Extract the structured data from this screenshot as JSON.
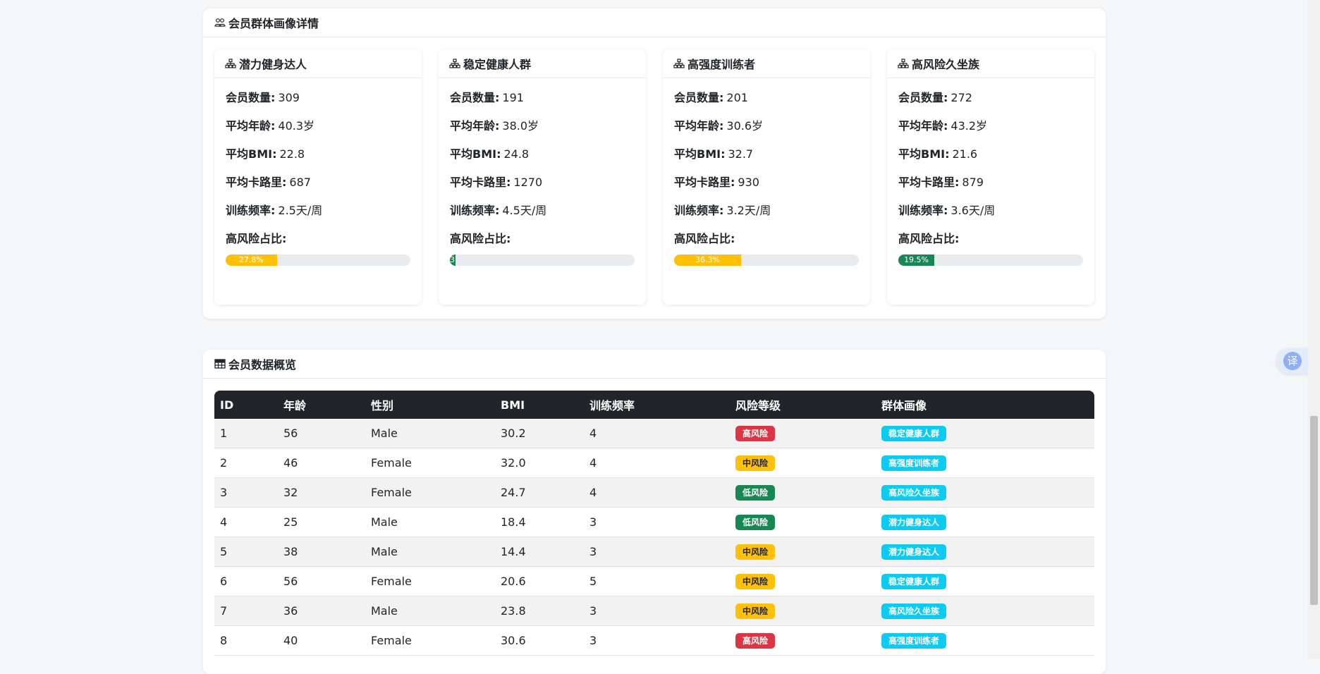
{
  "groups_section": {
    "title": "会员群体画像详情",
    "labels": {
      "count": "会员数量:",
      "age": "平均年龄:",
      "bmi": "平均BMI:",
      "calories": "平均卡路里:",
      "freq": "训练频率:",
      "risk_ratio": "高风险占比:"
    },
    "cards": [
      {
        "name": "潜力健身达人",
        "count": "309",
        "age": "40.3岁",
        "bmi": "22.8",
        "calories": "687",
        "freq": "2.5天/周",
        "risk_pct": 27.8,
        "risk_text": "27.8%",
        "risk_color": "#ffc107"
      },
      {
        "name": "稳定健康人群",
        "count": "191",
        "age": "38.0岁",
        "bmi": "24.8",
        "calories": "1270",
        "freq": "4.5天/周",
        "risk_pct": 3.1,
        "risk_text": "3.",
        "risk_color": "#198754"
      },
      {
        "name": "高强度训练者",
        "count": "201",
        "age": "30.6岁",
        "bmi": "32.7",
        "calories": "930",
        "freq": "3.2天/周",
        "risk_pct": 36.3,
        "risk_text": "36.3%",
        "risk_color": "#ffc107"
      },
      {
        "name": "高风险久坐族",
        "count": "272",
        "age": "43.2岁",
        "bmi": "21.6",
        "calories": "879",
        "freq": "3.6天/周",
        "risk_pct": 19.5,
        "risk_text": "19.5%",
        "risk_color": "#198754"
      }
    ]
  },
  "table_section": {
    "title": "会员数据概览",
    "columns": [
      "ID",
      "年龄",
      "性别",
      "BMI",
      "训练频率",
      "风险等级",
      "群体画像"
    ],
    "rows": [
      {
        "id": "1",
        "age": "56",
        "gender": "Male",
        "bmi": "30.2",
        "freq": "4",
        "risk": "高风险",
        "risk_level": "high",
        "group": "稳定健康人群"
      },
      {
        "id": "2",
        "age": "46",
        "gender": "Female",
        "bmi": "32.0",
        "freq": "4",
        "risk": "中风险",
        "risk_level": "mid",
        "group": "高强度训练者"
      },
      {
        "id": "3",
        "age": "32",
        "gender": "Female",
        "bmi": "24.7",
        "freq": "4",
        "risk": "低风险",
        "risk_level": "low",
        "group": "高风险久坐族"
      },
      {
        "id": "4",
        "age": "25",
        "gender": "Male",
        "bmi": "18.4",
        "freq": "3",
        "risk": "低风险",
        "risk_level": "low",
        "group": "潜力健身达人"
      },
      {
        "id": "5",
        "age": "38",
        "gender": "Male",
        "bmi": "14.4",
        "freq": "3",
        "risk": "中风险",
        "risk_level": "mid",
        "group": "潜力健身达人"
      },
      {
        "id": "6",
        "age": "56",
        "gender": "Female",
        "bmi": "20.6",
        "freq": "5",
        "risk": "中风险",
        "risk_level": "mid",
        "group": "稳定健康人群"
      },
      {
        "id": "7",
        "age": "36",
        "gender": "Male",
        "bmi": "23.8",
        "freq": "3",
        "risk": "中风险",
        "risk_level": "mid",
        "group": "高风险久坐族"
      },
      {
        "id": "8",
        "age": "40",
        "gender": "Female",
        "bmi": "30.6",
        "freq": "3",
        "risk": "高风险",
        "risk_level": "high",
        "group": "高强度训练者"
      }
    ]
  },
  "translate_button": {
    "label": "译"
  },
  "icons": {
    "groups_header": "people-icon",
    "card_header": "diagram-icon",
    "table_header": "table-icon"
  }
}
